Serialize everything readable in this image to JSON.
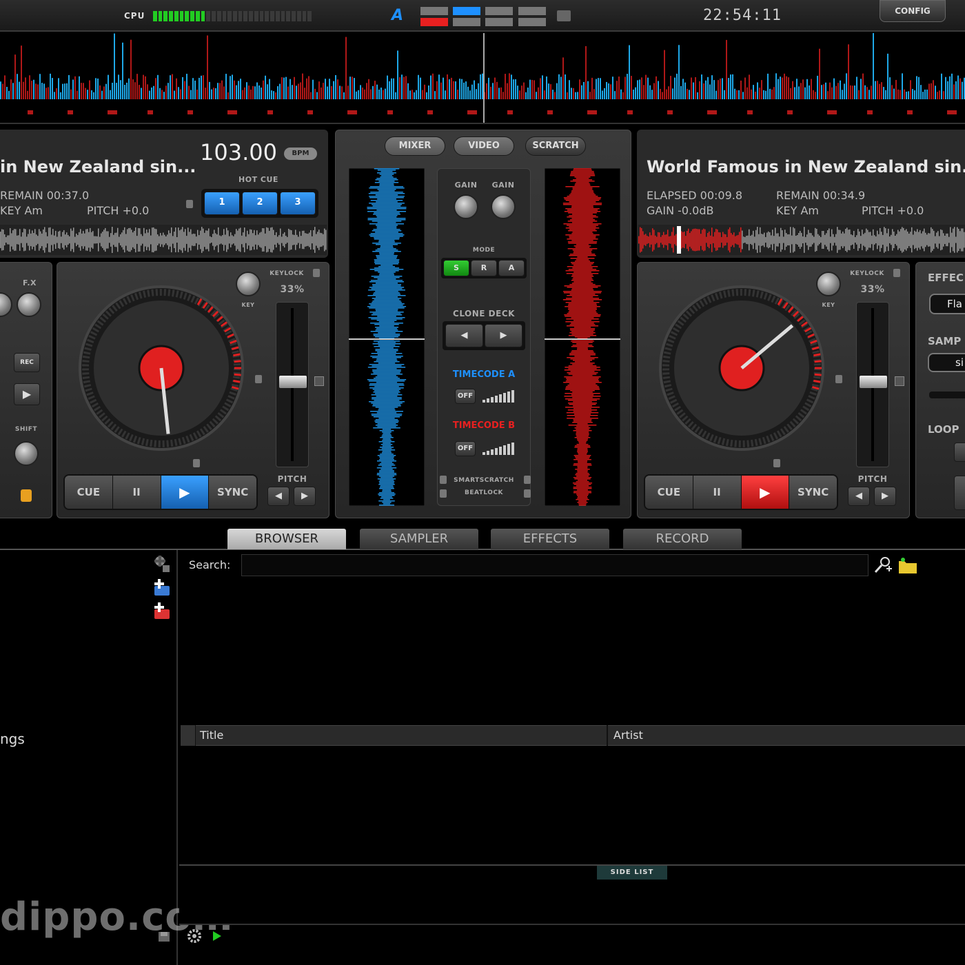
{
  "topbar": {
    "cpu_label": "CPU",
    "layout_label": "A",
    "clock": "22:54:11",
    "config_label": "CONFIG"
  },
  "deck_left": {
    "title": "in New Zealand sin...",
    "bpm": "103.00",
    "bpm_label": "BPM",
    "remain": "REMAIN 00:37.0",
    "key": "KEY Am",
    "pitch": "PITCH +0.0",
    "hot_cue_label": "HOT CUE",
    "hot_cues": [
      "1",
      "2",
      "3"
    ],
    "keylock_label": "KEYLOCK",
    "keylock_value": "33%",
    "key_label": "KEY",
    "pitch_label": "PITCH",
    "fx_label": "F.X",
    "rec_label": "REC",
    "shift_label": "SHIFT",
    "cue": "CUE",
    "pause": "II",
    "sync": "SYNC",
    "accent": "#1e90ff"
  },
  "deck_right": {
    "title": "World Famous in New Zealand sin...",
    "elapsed": "ELAPSED 00:09.8",
    "remain": "REMAIN 00:34.9",
    "gain": "GAIN -0.0dB",
    "key": "KEY Am",
    "pitch": "PITCH +0.0",
    "keylock_label": "KEYLOCK",
    "keylock_value": "33%",
    "key_label": "KEY",
    "pitch_label": "PITCH",
    "cue": "CUE",
    "pause": "II",
    "sync": "SYNC",
    "effect_label": "EFFEC",
    "effect_value": "Fla",
    "sampler_label": "SAMP",
    "sampler_value": "si",
    "loop_label": "LOOP",
    "accent": "#e82020"
  },
  "mixer": {
    "tabs": [
      "MIXER",
      "VIDEO",
      "SCRATCH"
    ],
    "gain_left": "GAIN",
    "gain_right": "GAIN",
    "mode_label": "MODE",
    "mode_buttons": [
      "S",
      "R",
      "A"
    ],
    "clone_deck_label": "CLONE DECK",
    "timecode_a": "TIMECODE A",
    "timecode_b": "TIMECODE B",
    "off_a": "OFF",
    "off_b": "OFF",
    "smartscratch": "SMARTSCRATCH",
    "beatlock": "BEATLOCK"
  },
  "bottom_tabs": [
    "BROWSER",
    "SAMPLER",
    "EFFECTS",
    "RECORD"
  ],
  "browser": {
    "search_label": "Search:",
    "search_value": "",
    "columns": [
      "Title",
      "Artist"
    ],
    "tree_item": "ngs",
    "side_list": "SIDE LIST",
    "watermark": "dippo.com"
  }
}
